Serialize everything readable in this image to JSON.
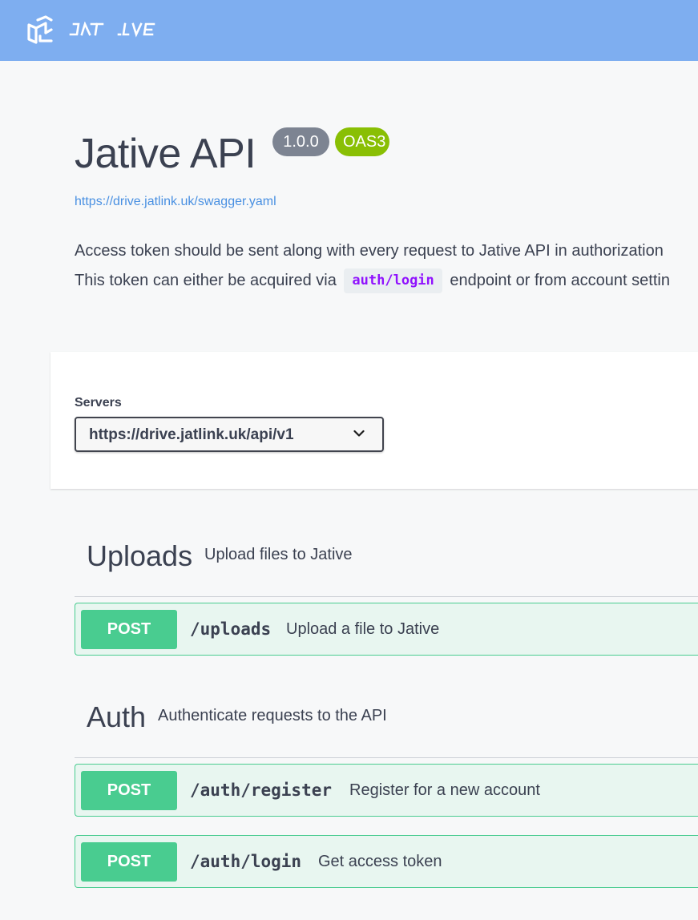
{
  "topbar": {
    "logo_icon": "jative-logo-icon",
    "brand_color": "#7eaef0"
  },
  "info": {
    "title": "Jative API",
    "version": "1.0.0",
    "oas_badge": "OAS3",
    "spec_url": "https://drive.jatlink.uk/swagger.yaml",
    "description_line1": "Access token should be sent along with every request to Jative API in authorization",
    "description_line2_before": "This token can either be acquired via",
    "description_code": "auth/login",
    "description_line2_after": "endpoint or from account settin"
  },
  "servers": {
    "label": "Servers",
    "selected": "https://drive.jatlink.uk/api/v1"
  },
  "tags": [
    {
      "name": "Uploads",
      "description": "Upload files to Jative",
      "operations": [
        {
          "method": "POST",
          "path": "/uploads",
          "summary": "Upload a file to Jative"
        }
      ]
    },
    {
      "name": "Auth",
      "description": "Authenticate requests to the API",
      "operations": [
        {
          "method": "POST",
          "path": "/auth/register",
          "summary": "Register for a new account"
        },
        {
          "method": "POST",
          "path": "/auth/login",
          "summary": "Get access token"
        }
      ]
    }
  ],
  "colors": {
    "post_method": "#49cc90",
    "post_bg": "#e8f6f0",
    "version_badge": "#7d8492",
    "oas_badge": "#89bf04",
    "link": "#4990e2",
    "code": "#9012fe"
  }
}
